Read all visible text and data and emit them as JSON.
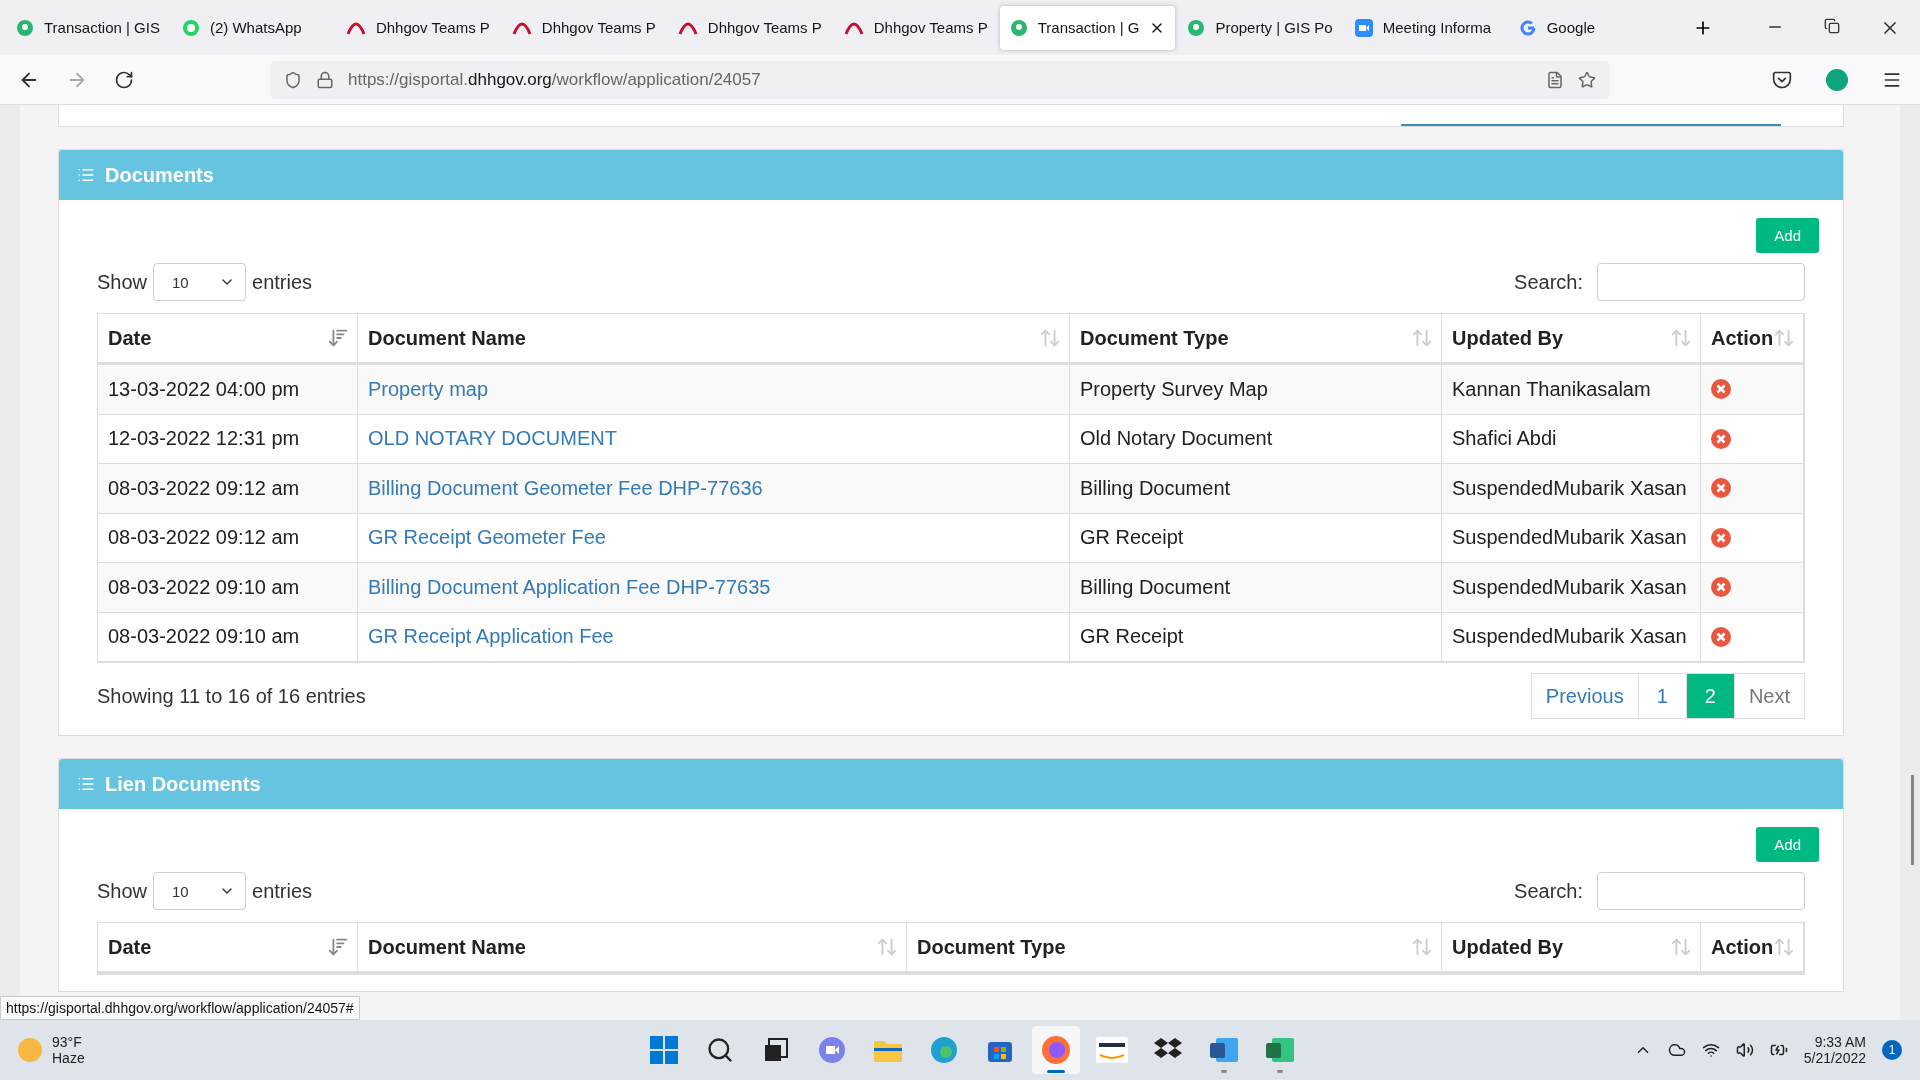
{
  "browser": {
    "tabs": [
      {
        "title": "Transaction | GIS",
        "kind": "gis",
        "selected": false
      },
      {
        "title": "(2) WhatsApp",
        "kind": "whatsapp",
        "selected": false
      },
      {
        "title": "Dhhgov Teams P",
        "kind": "teams",
        "selected": false
      },
      {
        "title": "Dhhgov Teams P",
        "kind": "teams",
        "selected": false
      },
      {
        "title": "Dhhgov Teams P",
        "kind": "teams",
        "selected": false
      },
      {
        "title": "Dhhgov Teams P",
        "kind": "teams",
        "selected": false
      },
      {
        "title": "Transaction | G",
        "kind": "gis",
        "selected": true
      },
      {
        "title": "Property | GIS Po",
        "kind": "gis",
        "selected": false
      },
      {
        "title": "Meeting Informa",
        "kind": "zoom",
        "selected": false
      },
      {
        "title": "Google",
        "kind": "google",
        "selected": false
      }
    ],
    "url_prefix": "https://gisportal.",
    "url_domain": "dhhgov.org",
    "url_path": "/workflow/application/24057",
    "status_url": "https://gisportal.dhhgov.org/workflow/application/24057#"
  },
  "sections": [
    {
      "title": "Documents",
      "add_button": "Add",
      "show_label": "Show",
      "page_size": "10",
      "entries_label": "entries",
      "search_label": "Search:",
      "columns": [
        {
          "label": "Date",
          "sorted": true
        },
        {
          "label": "Document Name",
          "sorted": false
        },
        {
          "label": "Document Type",
          "sorted": false
        },
        {
          "label": "Updated By",
          "sorted": false
        },
        {
          "label": "Action",
          "sorted": false
        }
      ],
      "rows": [
        {
          "date": "13-03-2022 04:00 pm",
          "name": "Property map",
          "type": "Property Survey Map",
          "updated_by": "Kannan Thanikasalam"
        },
        {
          "date": "12-03-2022 12:31 pm",
          "name": "OLD NOTARY DOCUMENT",
          "type": "Old Notary Document",
          "updated_by": "Shafici Abdi"
        },
        {
          "date": "08-03-2022 09:12 am",
          "name": "Billing Document Geometer Fee DHP-77636",
          "type": "Billing Document",
          "updated_by": "SuspendedMubarik Xasan"
        },
        {
          "date": "08-03-2022 09:12 am",
          "name": "GR Receipt Geometer Fee",
          "type": "GR Receipt",
          "updated_by": "SuspendedMubarik Xasan"
        },
        {
          "date": "08-03-2022 09:10 am",
          "name": "Billing Document Application Fee DHP-77635",
          "type": "Billing Document",
          "updated_by": "SuspendedMubarik Xasan"
        },
        {
          "date": "08-03-2022 09:10 am",
          "name": "GR Receipt Application Fee",
          "type": "GR Receipt",
          "updated_by": "SuspendedMubarik Xasan"
        }
      ],
      "info": "Showing 11 to 16 of 16 entries",
      "pagination": [
        {
          "label": "Previous",
          "kind": "nav",
          "selected": false
        },
        {
          "label": "1",
          "kind": "page",
          "selected": false
        },
        {
          "label": "2",
          "kind": "page",
          "selected": true
        },
        {
          "label": "Next",
          "kind": "nav",
          "selected": false
        }
      ]
    },
    {
      "title": "Lien Documents",
      "add_button": "Add",
      "show_label": "Show",
      "page_size": "10",
      "entries_label": "entries",
      "search_label": "Search:",
      "columns": [
        {
          "label": "Date",
          "sorted": true
        },
        {
          "label": "Document Name",
          "sorted": false
        },
        {
          "label": "Document Type",
          "sorted": false
        },
        {
          "label": "Updated By",
          "sorted": false
        },
        {
          "label": "Action",
          "sorted": false
        }
      ]
    }
  ],
  "taskbar": {
    "temperature": "93°F",
    "condition": "Haze",
    "time": "9:33 AM",
    "date": "5/21/2022",
    "notifications": "1",
    "apps": [
      {
        "kind": "start",
        "running": false,
        "selected": false
      },
      {
        "kind": "search",
        "running": false,
        "selected": false
      },
      {
        "kind": "taskview",
        "running": false,
        "selected": false
      },
      {
        "kind": "chat",
        "running": false,
        "selected": false
      },
      {
        "kind": "folder",
        "running": false,
        "selected": false
      },
      {
        "kind": "edge",
        "running": false,
        "selected": false
      },
      {
        "kind": "store",
        "running": false,
        "selected": false
      },
      {
        "kind": "firefox",
        "running": true,
        "selected": true
      },
      {
        "kind": "amazon",
        "running": false,
        "selected": false
      },
      {
        "kind": "dropbox",
        "running": false,
        "selected": false
      },
      {
        "kind": "word",
        "running": true,
        "selected": false
      },
      {
        "kind": "excel",
        "running": true,
        "selected": false
      }
    ]
  }
}
